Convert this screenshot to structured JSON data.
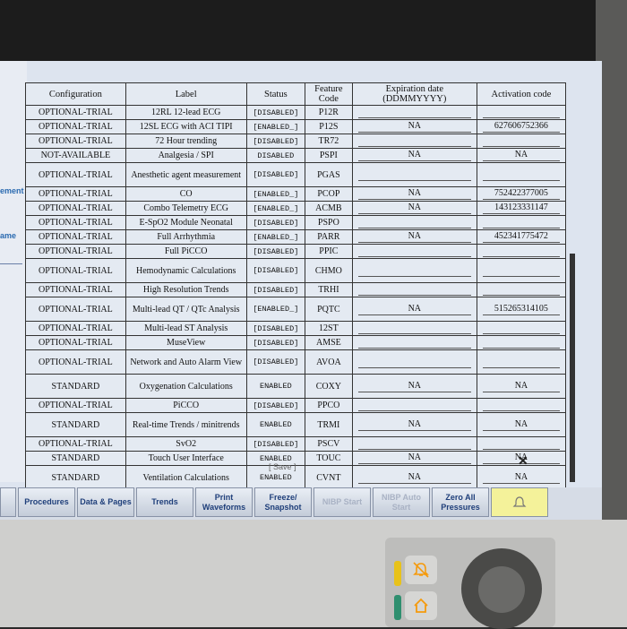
{
  "sidebar": {
    "labels": [
      "ement",
      "ame"
    ]
  },
  "table": {
    "headers": [
      "Configuration",
      "Label",
      "Status",
      "Feature Code",
      "Expiration date (DDMMYYYY)",
      "Activation code"
    ],
    "rows": [
      {
        "config": "OPTIONAL-TRIAL",
        "label": "12RL 12-lead ECG",
        "status": "[DISABLED]",
        "code": "P12R",
        "exp": "",
        "act": ""
      },
      {
        "config": "OPTIONAL-TRIAL",
        "label": "12SL ECG with ACI TIPI",
        "status": "[ENABLED_]",
        "code": "P12S",
        "exp": "NA",
        "act": "627606752366"
      },
      {
        "config": "OPTIONAL-TRIAL",
        "label": "72 Hour trending",
        "status": "[DISABLED]",
        "code": "TR72",
        "exp": "",
        "act": ""
      },
      {
        "config": "NOT-AVAILABLE",
        "label": "Analgesia / SPI",
        "status": "DISABLED",
        "code": "PSPI",
        "exp": "NA",
        "act": "NA"
      },
      {
        "config": "OPTIONAL-TRIAL",
        "label": "Anesthetic agent measurement",
        "status": "[DISABLED]",
        "code": "PGAS",
        "exp": "",
        "act": ""
      },
      {
        "config": "OPTIONAL-TRIAL",
        "label": "CO",
        "status": "[ENABLED_]",
        "code": "PCOP",
        "exp": "NA",
        "act": "752422377005"
      },
      {
        "config": "OPTIONAL-TRIAL",
        "label": "Combo Telemetry ECG",
        "status": "[ENABLED_]",
        "code": "ACMB",
        "exp": "NA",
        "act": "143123331147"
      },
      {
        "config": "OPTIONAL-TRIAL",
        "label": "E-SpO2 Module Neonatal",
        "status": "[DISABLED]",
        "code": "PSPO",
        "exp": "",
        "act": ""
      },
      {
        "config": "OPTIONAL-TRIAL",
        "label": "Full Arrhythmia",
        "status": "[ENABLED_]",
        "code": "PARR",
        "exp": "NA",
        "act": "452341775472"
      },
      {
        "config": "OPTIONAL-TRIAL",
        "label": "Full PiCCO",
        "status": "[DISABLED]",
        "code": "PPIC",
        "exp": "",
        "act": ""
      },
      {
        "config": "OPTIONAL-TRIAL",
        "label": "Hemodynamic Calculations",
        "status": "[DISABLED]",
        "code": "CHMO",
        "exp": "",
        "act": ""
      },
      {
        "config": "OPTIONAL-TRIAL",
        "label": "High Resolution Trends",
        "status": "[DISABLED]",
        "code": "TRHI",
        "exp": "",
        "act": ""
      },
      {
        "config": "OPTIONAL-TRIAL",
        "label": "Multi-lead QT / QTc Analysis",
        "status": "[ENABLED_]",
        "code": "PQTC",
        "exp": "NA",
        "act": "515265314105"
      },
      {
        "config": "OPTIONAL-TRIAL",
        "label": "Multi-lead ST Analysis",
        "status": "[DISABLED]",
        "code": "12ST",
        "exp": "",
        "act": ""
      },
      {
        "config": "OPTIONAL-TRIAL",
        "label": "MuseView",
        "status": "[DISABLED]",
        "code": "AMSE",
        "exp": "",
        "act": ""
      },
      {
        "config": "OPTIONAL-TRIAL",
        "label": "Network and Auto Alarm View",
        "status": "[DISABLED]",
        "code": "AVOA",
        "exp": "",
        "act": ""
      },
      {
        "config": "STANDARD",
        "label": "Oxygenation Calculations",
        "status": "ENABLED",
        "code": "COXY",
        "exp": "NA",
        "act": "NA"
      },
      {
        "config": "OPTIONAL-TRIAL",
        "label": "PiCCO",
        "status": "[DISABLED]",
        "code": "PPCO",
        "exp": "",
        "act": ""
      },
      {
        "config": "STANDARD",
        "label": "Real-time Trends / minitrends",
        "status": "ENABLED",
        "code": "TRMI",
        "exp": "NA",
        "act": "NA"
      },
      {
        "config": "OPTIONAL-TRIAL",
        "label": "SvO2",
        "status": "[DISABLED]",
        "code": "PSCV",
        "exp": "",
        "act": ""
      },
      {
        "config": "STANDARD",
        "label": "Touch User Interface",
        "status": "ENABLED",
        "code": "TOUC",
        "exp": "NA",
        "act": "NA"
      },
      {
        "config": "STANDARD",
        "label": "Ventilation Calculations",
        "status": "ENABLED",
        "code": "CVNT",
        "exp": "NA",
        "act": "NA"
      }
    ]
  },
  "footer": {
    "save_label": "[ Save ]",
    "close_label": "✕"
  },
  "softkeys": [
    {
      "label": "",
      "enabled": true
    },
    {
      "label": "Procedures",
      "enabled": true
    },
    {
      "label": "Data & Pages",
      "enabled": true
    },
    {
      "label": "Trends",
      "enabled": true
    },
    {
      "label": "Print Waveforms",
      "enabled": true
    },
    {
      "label": "Freeze/ Snapshot",
      "enabled": true
    },
    {
      "label": "NIBP Start",
      "enabled": false
    },
    {
      "label": "NIBP Auto Start",
      "enabled": false
    },
    {
      "label": "Zero All Pressures",
      "enabled": true
    },
    {
      "label": "",
      "enabled": true,
      "alarm": true
    }
  ],
  "colors": {
    "screen_bg": "#dde4ef",
    "key_text": "#1f3f7a",
    "alarm_yellow": "#f4f29a",
    "hw_orange": "#f59a0c"
  },
  "icons": {
    "alarm_silence": "alarm-silence-icon",
    "home": "home-icon"
  }
}
